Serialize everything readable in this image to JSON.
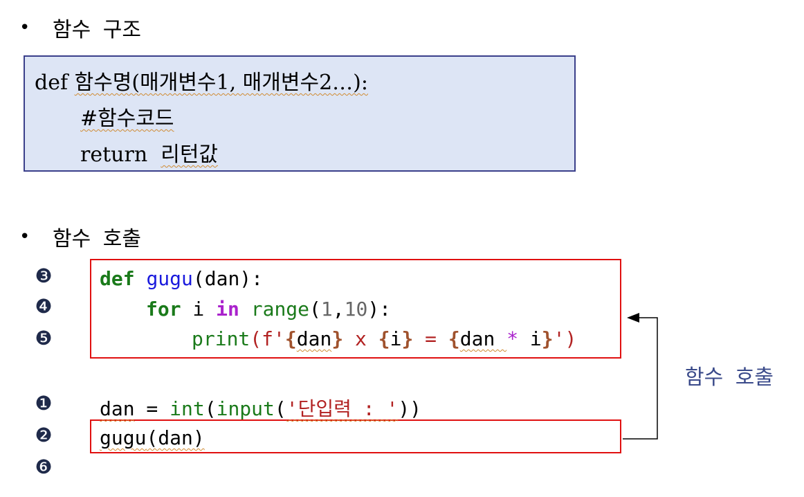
{
  "sections": {
    "structure_title": "함수 구조",
    "call_title": "함수 호출",
    "bullet": "•"
  },
  "structure_box": {
    "line1_kw": "def",
    "line1_rest": "함수명(매개변수1, 매개변수2…):",
    "line2": "#함수코드",
    "line3_kw": "return",
    "line3_rest": "리턴값"
  },
  "markers": [
    "❸",
    "❹",
    "❺",
    "❶",
    "❷",
    "❻"
  ],
  "code": {
    "def_kw": "def",
    "fn_name": "gugu",
    "def_rest": "(dan):",
    "for_kw": "for",
    "for_var": " i ",
    "in_kw": "in",
    "range_fn": "range",
    "range_open": "(",
    "range_n1": "1",
    "range_comma": ",",
    "range_n2": "10",
    "range_close": "):",
    "print_fn": "print",
    "print_open": "(f'",
    "b1": "{",
    "v1": "dan",
    "b2": "}",
    "mid1": " x ",
    "b3": "{",
    "v2": "i",
    "b4": "}",
    "mid2": " = ",
    "b5": "{",
    "v3": "dan ",
    "star": "*",
    "v4": " i",
    "b6": "}",
    "print_close": "')",
    "dan_var": "dan",
    "assign": " = ",
    "int_fn": "int",
    "input_open": "(",
    "input_fn": "input",
    "input_paren": "(",
    "input_str": "'단입력 : '",
    "input_close": "))",
    "call_fn": "gugu",
    "call_rest": "(dan)"
  },
  "arrow_label": "함수 호출",
  "colors": {
    "box_fill": "#dde5f5",
    "box_border": "#3a3f8a",
    "red_border": "#e01010",
    "arrow_text": "#3a4a8a"
  }
}
